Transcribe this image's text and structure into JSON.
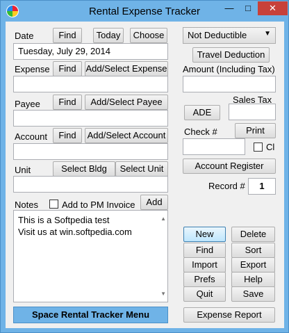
{
  "window": {
    "title": "Rental Expense Tracker",
    "minimize": "—",
    "maximize": "□",
    "close": "✕"
  },
  "date": {
    "label": "Date",
    "find": "Find",
    "today": "Today",
    "choose": "Choose",
    "value": "Tuesday, July 29, 2014"
  },
  "deductible": {
    "selected": "Not Deductible"
  },
  "travel_deduction": "Travel Deduction",
  "expense": {
    "label": "Expense",
    "find": "Find",
    "add_select": "Add/Select Expense",
    "value": ""
  },
  "amount": {
    "label": "Amount (Including Tax)",
    "value": ""
  },
  "payee": {
    "label": "Payee",
    "find": "Find",
    "add_select": "Add/Select Payee",
    "value": ""
  },
  "sales_tax": {
    "label": "Sales Tax",
    "ade": "ADE",
    "value": ""
  },
  "account": {
    "label": "Account",
    "find": "Find",
    "add_select": "Add/Select Account",
    "value": ""
  },
  "check": {
    "label": "Check #",
    "print": "Print",
    "value": "",
    "cl_label": "Cl"
  },
  "unit": {
    "label": "Unit",
    "select_bldg": "Select Bldg",
    "select_unit": "Select Unit",
    "value": ""
  },
  "account_register": "Account Register",
  "record": {
    "label": "Record #",
    "value": "1"
  },
  "notes": {
    "label": "Notes",
    "add_to_pm": "Add to PM Invoice",
    "add": "Add",
    "lines": [
      "This is a Softpedia test",
      "Visit us at win.softpedia.com"
    ]
  },
  "actions": {
    "new": "New",
    "delete": "Delete",
    "find": "Find",
    "sort": "Sort",
    "import": "Import",
    "export": "Export",
    "prefs": "Prefs",
    "help": "Help",
    "quit": "Quit",
    "save": "Save"
  },
  "space_menu": "Space Rental Tracker Menu",
  "expense_report": "Expense Report",
  "colors": {
    "chrome": "#6fb3e7",
    "close": "#c7413a",
    "panel": "#f0f0f0"
  }
}
